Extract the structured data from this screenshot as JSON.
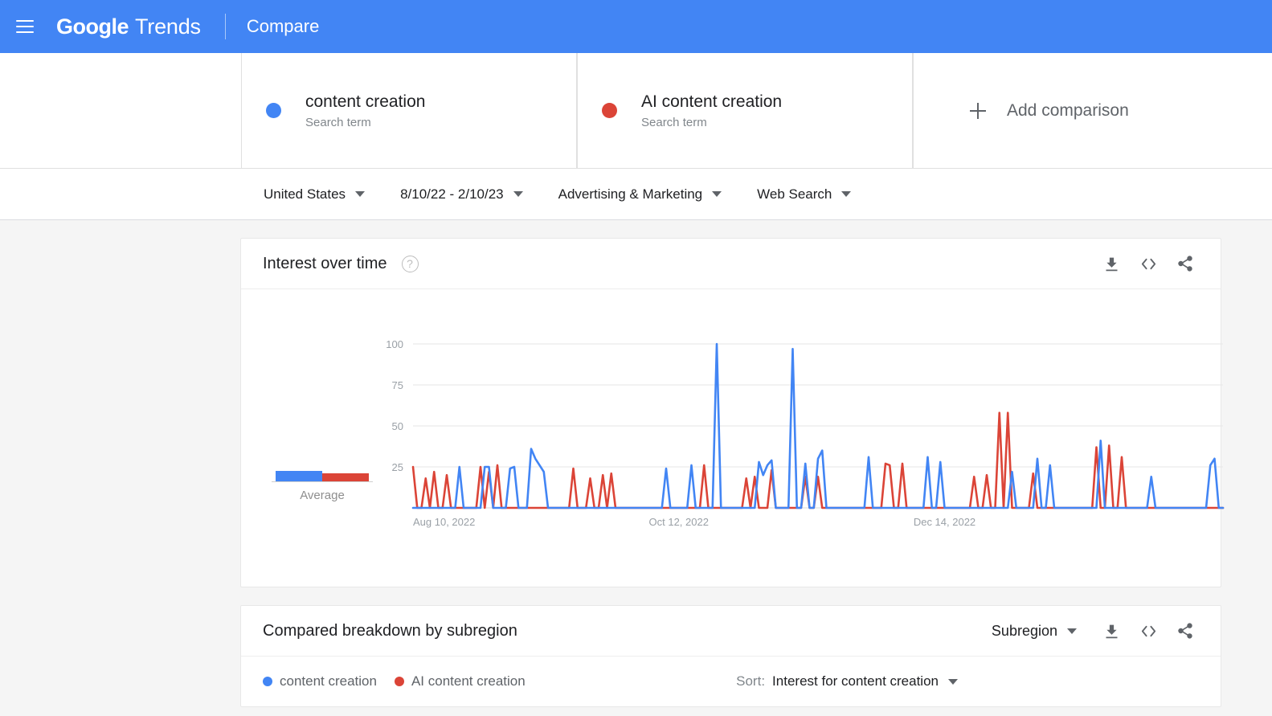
{
  "appbar": {
    "menu_icon": "hamburger-menu-icon",
    "brand_primary": "Google",
    "brand_secondary": "Trends",
    "section": "Compare"
  },
  "compare": {
    "items": [
      {
        "term": "content creation",
        "type_label": "Search term",
        "color": "#4285f4"
      },
      {
        "term": "AI content creation",
        "type_label": "Search term",
        "color": "#db4437"
      }
    ],
    "add_label": "Add comparison",
    "add_icon": "plus-icon"
  },
  "filters": [
    {
      "label": "United States",
      "name": "region-filter"
    },
    {
      "label": "8/10/22 - 2/10/23",
      "name": "date-range-filter"
    },
    {
      "label": "Advertising & Marketing",
      "name": "category-filter"
    },
    {
      "label": "Web Search",
      "name": "search-type-filter"
    }
  ],
  "interest_card": {
    "title": "Interest over time",
    "help_glyph": "?",
    "actions": [
      {
        "name": "download-icon",
        "label": "Download CSV"
      },
      {
        "name": "embed-code-icon",
        "label": "Embed"
      },
      {
        "name": "share-icon",
        "label": "Share"
      }
    ],
    "average_label": "Average"
  },
  "subregion_card": {
    "title": "Compared breakdown by subregion",
    "subregion_select": "Subregion",
    "legend": [
      {
        "label": "content creation",
        "color": "#4285f4"
      },
      {
        "label": "AI content creation",
        "color": "#db4437"
      }
    ],
    "sort_label": "Sort:",
    "sort_value": "Interest for content creation",
    "actions": [
      {
        "name": "download-icon",
        "label": "Download CSV"
      },
      {
        "name": "embed-code-icon",
        "label": "Embed"
      },
      {
        "name": "share-icon",
        "label": "Share"
      }
    ]
  },
  "chart_data": {
    "type": "line",
    "title": "Interest over time",
    "xlabel": "",
    "ylabel": "",
    "ylim": [
      0,
      100
    ],
    "yticks": [
      25,
      50,
      75,
      100
    ],
    "grid": true,
    "legend_position": "external-top",
    "x_tick_labels": [
      "Aug 10, 2022",
      "Oct 12, 2022",
      "Dec 14, 2022"
    ],
    "x_tick_indices": [
      0,
      63,
      126
    ],
    "average_bars": {
      "content creation": 8,
      "AI content creation": 6
    },
    "series": [
      {
        "name": "content creation",
        "color": "#4285f4",
        "values": [
          0,
          0,
          0,
          0,
          0,
          0,
          0,
          0,
          0,
          0,
          0,
          25,
          0,
          0,
          0,
          0,
          0,
          25,
          25,
          0,
          0,
          0,
          0,
          24,
          25,
          0,
          0,
          0,
          36,
          30,
          26,
          22,
          0,
          0,
          0,
          0,
          0,
          0,
          0,
          0,
          0,
          0,
          0,
          0,
          0,
          0,
          0,
          0,
          0,
          0,
          0,
          0,
          0,
          0,
          0,
          0,
          0,
          0,
          0,
          0,
          24,
          0,
          0,
          0,
          0,
          0,
          26,
          0,
          0,
          0,
          0,
          0,
          100,
          0,
          0,
          0,
          0,
          0,
          0,
          0,
          0,
          0,
          28,
          20,
          26,
          29,
          0,
          0,
          0,
          0,
          97,
          0,
          0,
          27,
          0,
          0,
          30,
          35,
          0,
          0,
          0,
          0,
          0,
          0,
          0,
          0,
          0,
          0,
          31,
          0,
          0,
          0,
          0,
          0,
          0,
          0,
          0,
          0,
          0,
          0,
          0,
          0,
          31,
          0,
          0,
          28,
          0,
          0,
          0,
          0,
          0,
          0,
          0,
          0,
          0,
          0,
          0,
          0,
          0,
          0,
          0,
          0,
          22,
          0,
          0,
          0,
          0,
          0,
          30,
          0,
          0,
          26,
          0,
          0,
          0,
          0,
          0,
          0,
          0,
          0,
          0,
          0,
          0,
          41,
          0,
          0,
          0,
          0,
          0,
          0,
          0,
          0,
          0,
          0,
          0,
          19,
          0,
          0,
          0,
          0,
          0,
          0,
          0,
          0,
          0,
          0,
          0,
          0,
          0,
          26,
          30,
          0,
          0
        ]
      },
      {
        "name": "AI content creation",
        "color": "#db4437",
        "values": [
          25,
          0,
          0,
          18,
          0,
          22,
          0,
          0,
          20,
          0,
          0,
          0,
          0,
          0,
          0,
          0,
          25,
          0,
          22,
          0,
          26,
          0,
          0,
          0,
          0,
          0,
          0,
          0,
          0,
          0,
          0,
          0,
          0,
          0,
          0,
          0,
          0,
          0,
          24,
          0,
          0,
          0,
          18,
          0,
          0,
          20,
          0,
          21,
          0,
          0,
          0,
          0,
          0,
          0,
          0,
          0,
          0,
          0,
          0,
          0,
          0,
          0,
          0,
          0,
          0,
          0,
          0,
          0,
          0,
          26,
          0,
          0,
          0,
          0,
          0,
          0,
          0,
          0,
          0,
          18,
          0,
          19,
          0,
          0,
          0,
          23,
          0,
          0,
          0,
          0,
          0,
          0,
          0,
          19,
          0,
          0,
          19,
          0,
          0,
          0,
          0,
          0,
          0,
          0,
          0,
          0,
          0,
          0,
          0,
          0,
          0,
          0,
          27,
          26,
          0,
          0,
          27,
          0,
          0,
          0,
          0,
          0,
          0,
          0,
          0,
          0,
          0,
          0,
          0,
          0,
          0,
          0,
          0,
          19,
          0,
          0,
          20,
          0,
          0,
          58,
          0,
          58,
          0,
          0,
          0,
          0,
          0,
          21,
          0,
          0,
          0,
          0,
          0,
          0,
          0,
          0,
          0,
          0,
          0,
          0,
          0,
          0,
          37,
          0,
          0,
          38,
          0,
          0,
          31,
          0,
          0,
          0,
          0,
          0,
          0,
          0,
          0,
          0,
          0,
          0,
          0,
          0,
          0,
          0,
          0,
          0,
          0,
          0,
          0,
          0,
          0,
          0,
          0
        ]
      }
    ]
  }
}
